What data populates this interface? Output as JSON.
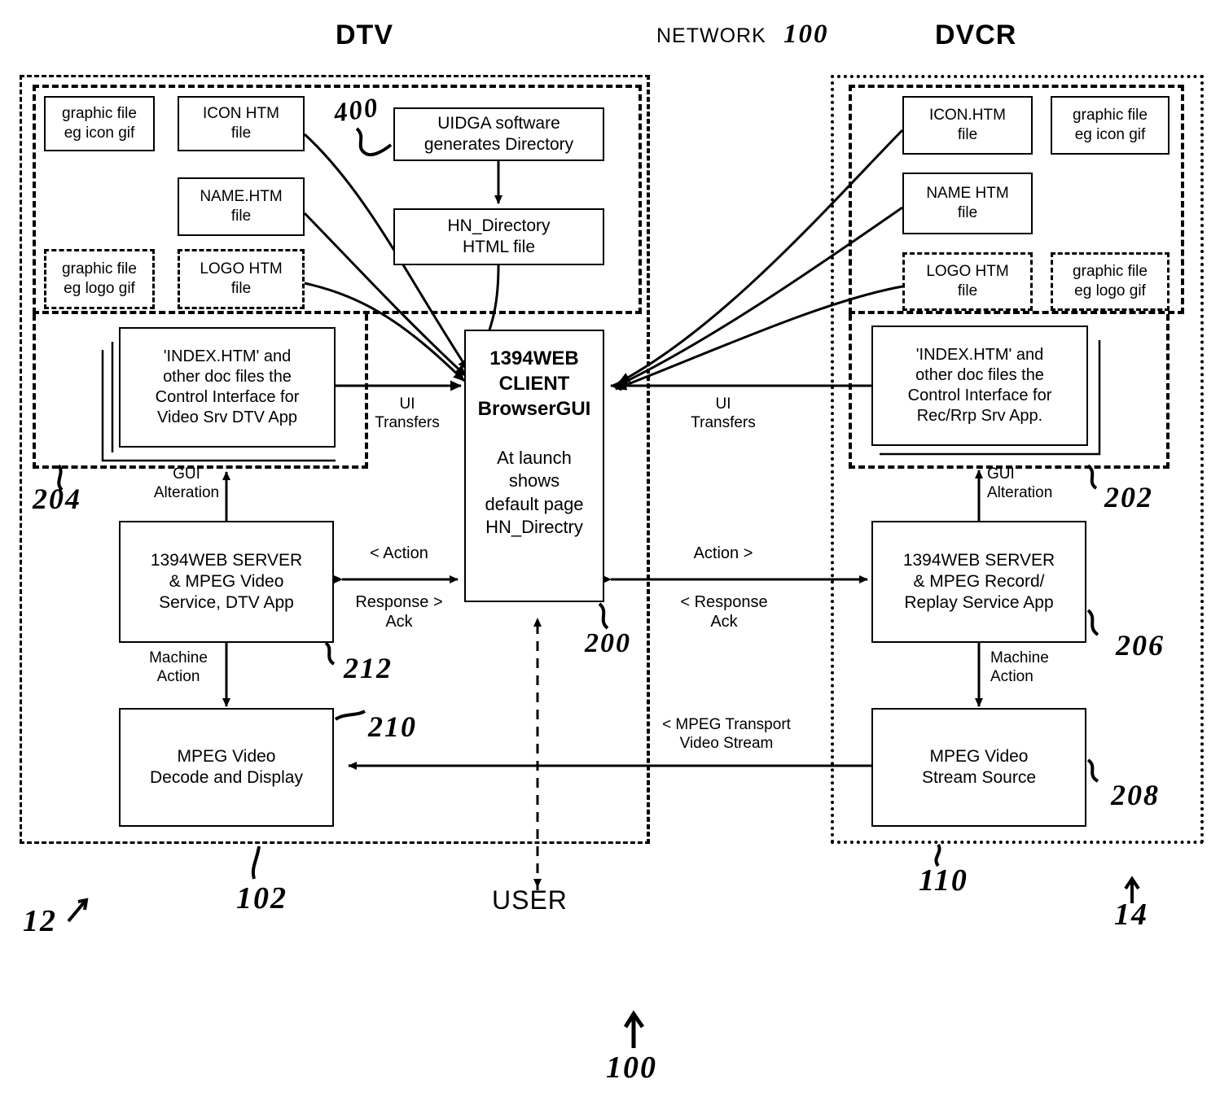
{
  "headers": {
    "dtv": "DTV",
    "network": "NETWORK",
    "network_ref": "100",
    "dvcr": "DVCR",
    "user": "USER"
  },
  "dtv": {
    "graphic_icon": "graphic file\neg icon gif",
    "icon_htm": "ICON HTM\nfile",
    "name_htm": "NAME.HTM\nfile",
    "graphic_logo": "graphic file\neg logo gif",
    "logo_htm": "LOGO HTM\nfile",
    "uidga": "UIDGA software\ngenerates Directory",
    "hn_directory": "HN_Directory\nHTML file",
    "index_htm": "'INDEX.HTM' and\nother doc  files the\nControl Interface for\nVideo Srv DTV App",
    "web_server": "1394WEB SERVER\n& MPEG Video\nService, DTV App",
    "mpeg_decode": "MPEG Video\nDecode and Display",
    "ui_transfers": "UI\nTransfers",
    "gui_alteration": "GUI\nAlteration",
    "action": "< Action",
    "response": "Response >\nAck",
    "machine_action": "Machine\nAction"
  },
  "dvcr": {
    "icon_htm": "ICON.HTM\nfile",
    "graphic_icon": "graphic file\neg icon gif",
    "name_htm": "NAME HTM\nfile",
    "logo_htm": "LOGO HTM\nfile",
    "graphic_logo": "graphic file\neg logo gif",
    "index_htm": "'INDEX.HTM' and\nother doc  files the\nControl Interface for\nRec/Rrp Srv App.",
    "web_server": "1394WEB SERVER\n& MPEG Record/\nReplay Service App",
    "mpeg_source": "MPEG Video\nStream Source",
    "ui_transfers": "UI\nTransfers",
    "gui_alteration": "GUI\nAlteration",
    "action": "Action >",
    "response": "< Response\nAck",
    "machine_action": "Machine\nAction",
    "mpeg_transport": "< MPEG Transport\nVideo Stream"
  },
  "client": {
    "title": "1394WEB\nCLIENT\nBrowserGUI",
    "body": "At launch\nshows\ndefault page\nHN_Directry"
  },
  "refs": {
    "r400": "400",
    "r204": "204",
    "r212": "212",
    "r210": "210",
    "r200": "200",
    "r202": "202",
    "r206": "206",
    "r208": "208",
    "r102": "102",
    "r110": "110",
    "r12": "12",
    "r14": "14",
    "r100": "100"
  },
  "chart_data": {
    "type": "table",
    "title": "1394WEB home-network block diagram"
  }
}
